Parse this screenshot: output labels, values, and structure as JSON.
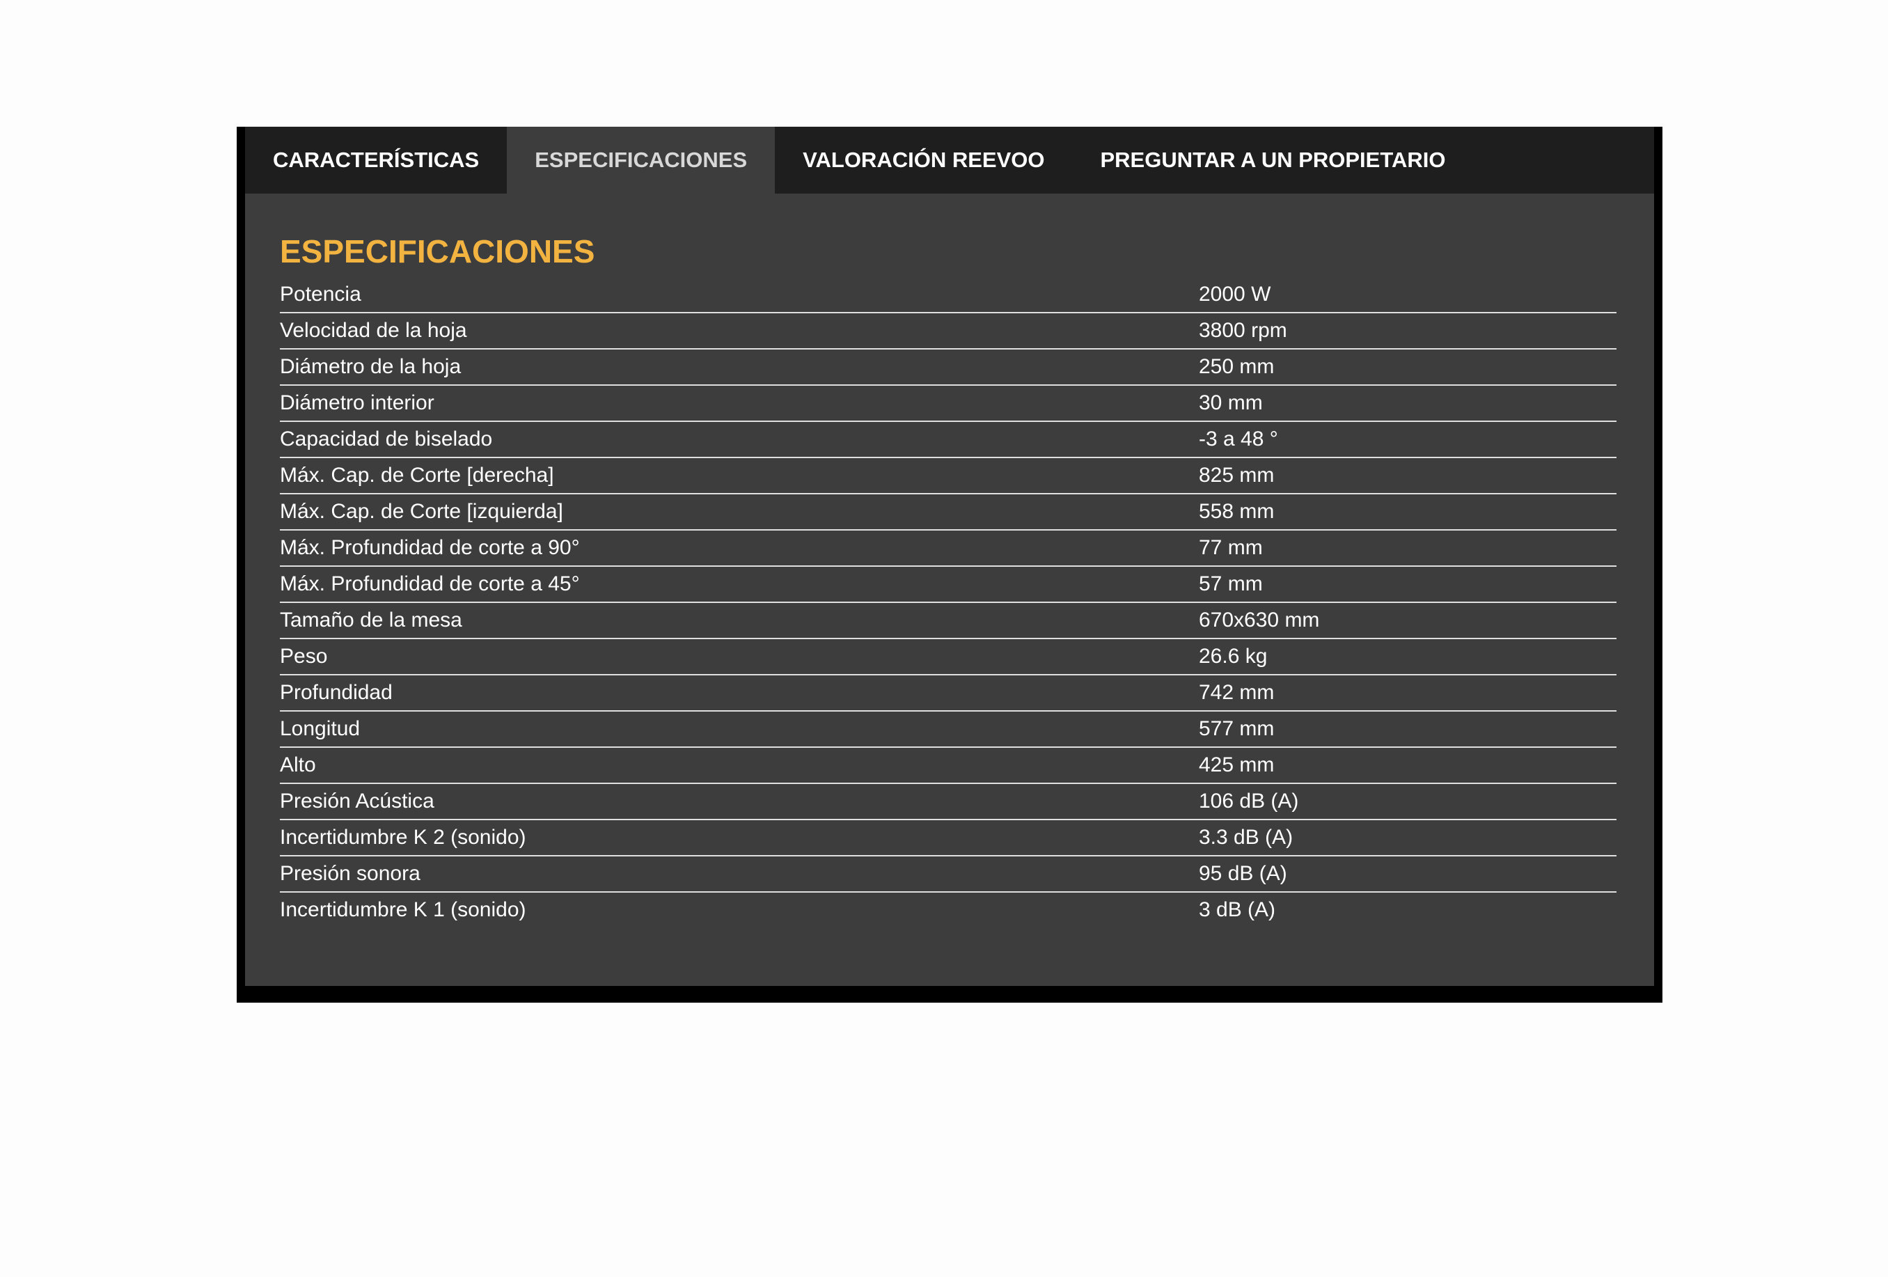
{
  "tabs": [
    {
      "label": "CARACTERÍSTICAS",
      "active": false
    },
    {
      "label": "ESPECIFICACIONES",
      "active": true
    },
    {
      "label": "VALORACIÓN REEVOO",
      "active": false
    },
    {
      "label": "PREGUNTAR A UN PROPIETARIO",
      "active": false
    }
  ],
  "panel": {
    "title": "ESPECIFICACIONES"
  },
  "specs": [
    {
      "label": "Potencia",
      "value": "2000 W"
    },
    {
      "label": "Velocidad de la hoja",
      "value": "3800 rpm"
    },
    {
      "label": "Diámetro de la hoja",
      "value": "250 mm"
    },
    {
      "label": "Diámetro interior",
      "value": "30 mm"
    },
    {
      "label": "Capacidad de biselado",
      "value": "-3 a 48 °"
    },
    {
      "label": "Máx. Cap. de Corte [derecha]",
      "value": "825 mm"
    },
    {
      "label": "Máx. Cap. de Corte [izquierda]",
      "value": "558 mm"
    },
    {
      "label": "Máx. Profundidad de corte a 90°",
      "value": "77 mm"
    },
    {
      "label": "Máx. Profundidad de corte a 45°",
      "value": "57 mm"
    },
    {
      "label": "Tamaño de la mesa",
      "value": "670x630 mm"
    },
    {
      "label": "Peso",
      "value": "26.6 kg"
    },
    {
      "label": "Profundidad",
      "value": "742 mm"
    },
    {
      "label": "Longitud",
      "value": "577 mm"
    },
    {
      "label": "Alto",
      "value": "425 mm"
    },
    {
      "label": "Presión Acústica",
      "value": "106 dB (A)"
    },
    {
      "label": "Incertidumbre K 2 (sonido)",
      "value": "3.3 dB (A)"
    },
    {
      "label": "Presión sonora",
      "value": "95 dB (A)"
    },
    {
      "label": "Incertidumbre K 1 (sonido)",
      "value": "3 dB (A)"
    }
  ],
  "colors": {
    "accent": "#f2b340",
    "panel_bg": "#3d3d3d",
    "tabbar_bg": "#1e1e1e",
    "frame": "#000000"
  }
}
